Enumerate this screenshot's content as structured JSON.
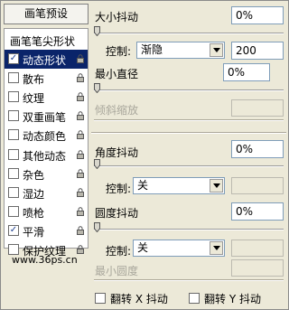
{
  "presets_button": "画笔预设",
  "list": {
    "header": "画笔笔尖形状",
    "items": [
      {
        "label": "动态形状",
        "checked": true,
        "selected": true
      },
      {
        "label": "散布",
        "checked": false,
        "selected": false
      },
      {
        "label": "纹理",
        "checked": false,
        "selected": false
      },
      {
        "label": "双重画笔",
        "checked": false,
        "selected": false
      },
      {
        "label": "动态颜色",
        "checked": false,
        "selected": false
      },
      {
        "label": "其他动态",
        "checked": false,
        "selected": false
      },
      {
        "label": "杂色",
        "checked": false,
        "selected": false
      },
      {
        "label": "湿边",
        "checked": false,
        "selected": false
      },
      {
        "label": "喷枪",
        "checked": false,
        "selected": false
      },
      {
        "label": "平滑",
        "checked": true,
        "selected": false
      },
      {
        "label": "保护纹理",
        "checked": false,
        "selected": false
      }
    ]
  },
  "watermark": "www.36ps.cn",
  "size_jitter": {
    "label": "大小抖动",
    "value": "0%"
  },
  "size_control": {
    "label": "控制:",
    "option": "渐隐",
    "value": "200"
  },
  "min_diameter": {
    "label": "最小直径",
    "value": "0%"
  },
  "tilt_scale": {
    "label": "倾斜缩放"
  },
  "angle_jitter": {
    "label": "角度抖动",
    "value": "0%"
  },
  "angle_control": {
    "label": "控制:",
    "option": "关"
  },
  "roundness_jitter": {
    "label": "圆度抖动",
    "value": "0%"
  },
  "roundness_control": {
    "label": "控制:",
    "option": "关"
  },
  "min_roundness": {
    "label": "最小圆度"
  },
  "flip_x": {
    "label": "翻转 X 抖动",
    "checked": false
  },
  "flip_y": {
    "label": "翻转 Y 抖动",
    "checked": false
  }
}
